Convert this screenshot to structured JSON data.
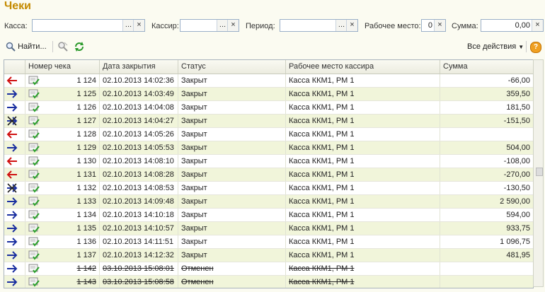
{
  "title": "Чеки",
  "filters": {
    "kassa_label": "Касса:",
    "kassir_label": "Кассир:",
    "period_label": "Период:",
    "workplace_label": "Рабочее место:",
    "workplace_value": "0",
    "sum_label": "Сумма:",
    "sum_value": "0,00",
    "select_btn": "...",
    "clear_btn": "×"
  },
  "toolbar": {
    "find_label": "Найти...",
    "all_actions_label": "Все действия",
    "help_label": "?"
  },
  "columns": {
    "number": "Номер чека",
    "date": "Дата закрытия",
    "status": "Статус",
    "workplace": "Рабочее место кассира",
    "sum": "Сумма"
  },
  "rows": [
    {
      "dir": "in",
      "num": "1 124",
      "date": "02.10.2013 14:02:36",
      "status": "Закрыт",
      "wp": "Касса ККМ1, РМ 1",
      "sum": "-66,00",
      "alt": false,
      "cancelled": false
    },
    {
      "dir": "out",
      "num": "1 125",
      "date": "02.10.2013 14:03:49",
      "status": "Закрыт",
      "wp": "Касса ККМ1, РМ 1",
      "sum": "359,50",
      "alt": true,
      "cancelled": false
    },
    {
      "dir": "out",
      "num": "1 126",
      "date": "02.10.2013 14:04:08",
      "status": "Закрыт",
      "wp": "Касса ККМ1, РМ 1",
      "sum": "181,50",
      "alt": false,
      "cancelled": false
    },
    {
      "dir": "x",
      "num": "1 127",
      "date": "02.10.2013 14:04:27",
      "status": "Закрыт",
      "wp": "Касса ККМ1, РМ 1",
      "sum": "-151,50",
      "alt": true,
      "cancelled": false
    },
    {
      "dir": "in",
      "num": "1 128",
      "date": "02.10.2013 14:05:26",
      "status": "Закрыт",
      "wp": "Касса ККМ1, РМ 1",
      "sum": "",
      "alt": false,
      "cancelled": false
    },
    {
      "dir": "out",
      "num": "1 129",
      "date": "02.10.2013 14:05:53",
      "status": "Закрыт",
      "wp": "Касса ККМ1, РМ 1",
      "sum": "504,00",
      "alt": true,
      "cancelled": false
    },
    {
      "dir": "in",
      "num": "1 130",
      "date": "02.10.2013 14:08:10",
      "status": "Закрыт",
      "wp": "Касса ККМ1, РМ 1",
      "sum": "-108,00",
      "alt": false,
      "cancelled": false
    },
    {
      "dir": "in",
      "num": "1 131",
      "date": "02.10.2013 14:08:28",
      "status": "Закрыт",
      "wp": "Касса ККМ1, РМ 1",
      "sum": "-270,00",
      "alt": true,
      "cancelled": false
    },
    {
      "dir": "x",
      "num": "1 132",
      "date": "02.10.2013 14:08:53",
      "status": "Закрыт",
      "wp": "Касса ККМ1, РМ 1",
      "sum": "-130,50",
      "alt": false,
      "cancelled": false
    },
    {
      "dir": "out",
      "num": "1 133",
      "date": "02.10.2013 14:09:48",
      "status": "Закрыт",
      "wp": "Касса ККМ1, РМ 1",
      "sum": "2 590,00",
      "alt": true,
      "cancelled": false
    },
    {
      "dir": "out",
      "num": "1 134",
      "date": "02.10.2013 14:10:18",
      "status": "Закрыт",
      "wp": "Касса ККМ1, РМ 1",
      "sum": "594,00",
      "alt": false,
      "cancelled": false
    },
    {
      "dir": "out",
      "num": "1 135",
      "date": "02.10.2013 14:10:57",
      "status": "Закрыт",
      "wp": "Касса ККМ1, РМ 1",
      "sum": "933,75",
      "alt": true,
      "cancelled": false
    },
    {
      "dir": "out",
      "num": "1 136",
      "date": "02.10.2013 14:11:51",
      "status": "Закрыт",
      "wp": "Касса ККМ1, РМ 1",
      "sum": "1 096,75",
      "alt": false,
      "cancelled": false
    },
    {
      "dir": "out",
      "num": "1 137",
      "date": "02.10.2013 14:12:32",
      "status": "Закрыт",
      "wp": "Касса ККМ1, РМ 1",
      "sum": "481,95",
      "alt": true,
      "cancelled": false
    },
    {
      "dir": "out",
      "num": "1 142",
      "date": "03.10.2013 15:08:01",
      "status": "Отменен",
      "wp": "Касса ККМ1, РМ 1",
      "sum": "",
      "alt": false,
      "cancelled": true
    },
    {
      "dir": "out",
      "num": "1 143",
      "date": "03.10.2013 15:08:58",
      "status": "Отменен",
      "wp": "Касса ККМ1, РМ 1",
      "sum": "",
      "alt": true,
      "cancelled": true
    }
  ],
  "colors": {
    "title": "#c48a00",
    "arrow_in": "#d01010",
    "arrow_out": "#1a2fa0",
    "alt_row": "#f1f5da"
  }
}
